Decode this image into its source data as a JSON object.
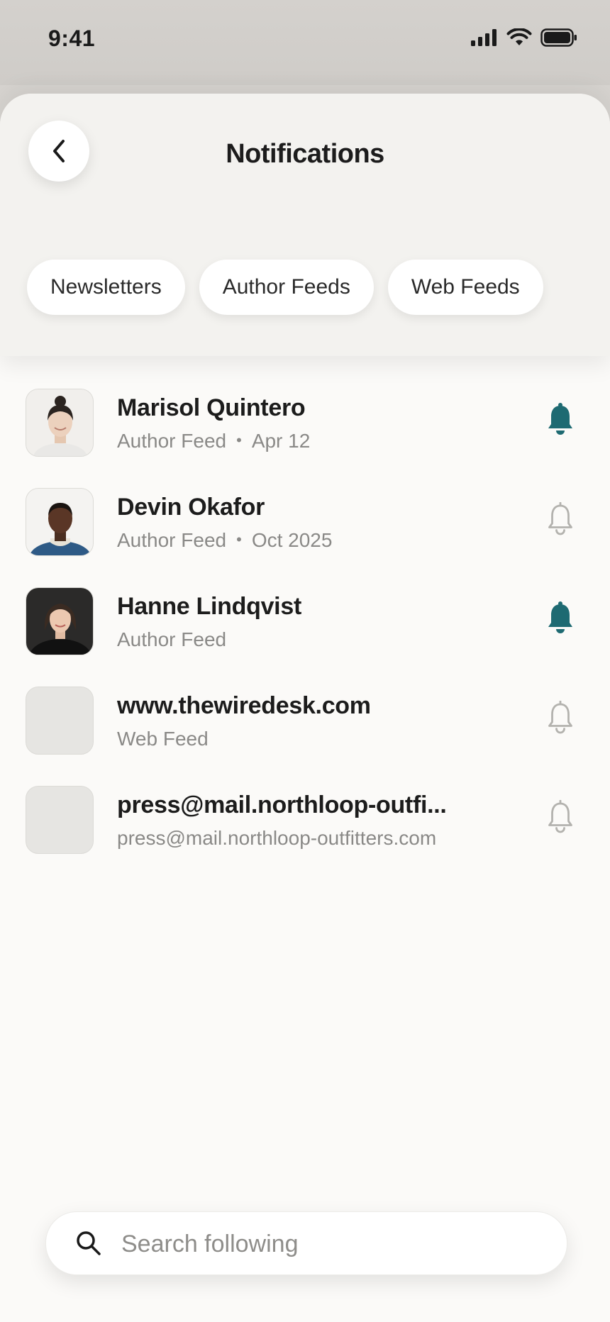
{
  "status_bar": {
    "time": "9:41"
  },
  "header": {
    "title": "Notifications",
    "back_icon": "chevron-left-icon"
  },
  "tabs": [
    {
      "label": "Newsletters"
    },
    {
      "label": "Author Feeds"
    },
    {
      "label": "Web Feeds"
    }
  ],
  "accent_color": "#1e6a72",
  "items": [
    {
      "title": "Marisol Quintero",
      "type": "Author Feed",
      "date": "Apr 12",
      "notifications_on": true
    },
    {
      "title": "Devin Okafor",
      "type": "Author Feed",
      "date": "Oct 2025",
      "notifications_on": false
    },
    {
      "title": "Hanne Lindqvist",
      "type": "Author Feed",
      "notifications_on": true
    },
    {
      "title": "www.thewiredesk.com",
      "type": "Web Feed",
      "notifications_on": false
    },
    {
      "title": "press@mail.northloop-outfi...",
      "type": "press@mail.northloop-outfitters.com",
      "notifications_on": false
    }
  ],
  "search": {
    "placeholder": "Search following"
  }
}
